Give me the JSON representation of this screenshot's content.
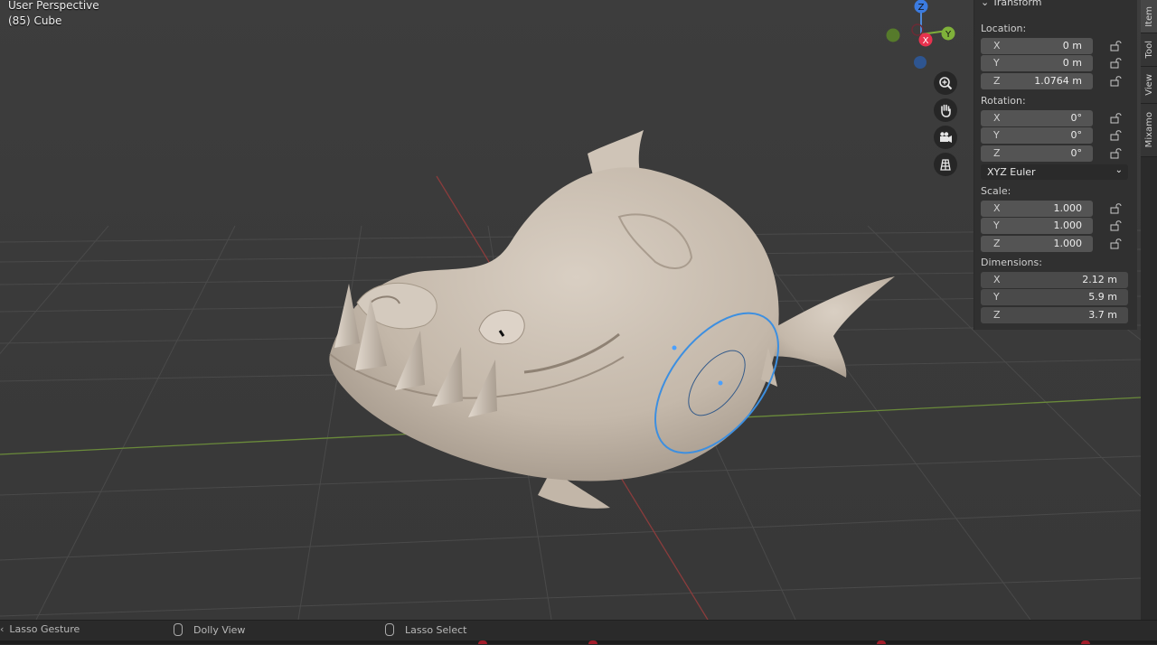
{
  "viewport": {
    "view_name": "User Perspective",
    "object_label": "(85) Cube",
    "gizmo": {
      "z": "Z",
      "y": "Y",
      "x": "X"
    }
  },
  "panel": {
    "title": "Transform",
    "location_label": "Location:",
    "location": [
      {
        "axis": "X",
        "value": "0 m"
      },
      {
        "axis": "Y",
        "value": "0 m"
      },
      {
        "axis": "Z",
        "value": "1.0764 m"
      }
    ],
    "rotation_label": "Rotation:",
    "rotation": [
      {
        "axis": "X",
        "value": "0°"
      },
      {
        "axis": "Y",
        "value": "0°"
      },
      {
        "axis": "Z",
        "value": "0°"
      }
    ],
    "rotation_mode": "XYZ Euler",
    "scale_label": "Scale:",
    "scale": [
      {
        "axis": "X",
        "value": "1.000"
      },
      {
        "axis": "Y",
        "value": "1.000"
      },
      {
        "axis": "Z",
        "value": "1.000"
      }
    ],
    "dimensions_label": "Dimensions:",
    "dimensions": [
      {
        "axis": "X",
        "value": "2.12 m"
      },
      {
        "axis": "Y",
        "value": "5.9 m"
      },
      {
        "axis": "Z",
        "value": "3.7 m"
      }
    ]
  },
  "tabs": [
    "Item",
    "Tool",
    "View",
    "Mixamo"
  ],
  "statusbar": {
    "left": "Lasso Gesture",
    "middle": "Dolly View",
    "right": "Lasso Select"
  }
}
